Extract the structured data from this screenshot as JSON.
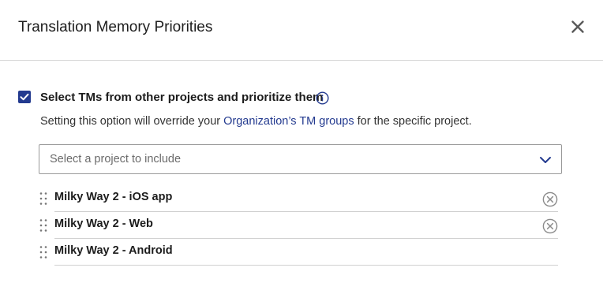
{
  "dialog": {
    "title": "Translation Memory Priorities",
    "close_icon": "close-icon"
  },
  "option": {
    "checked": true,
    "label": "Select TMs from other projects and prioritize them",
    "info_icon": "info-icon",
    "help_prefix": "Setting this option will override your ",
    "help_link": "Organization’s TM groups",
    "help_suffix": " for the specific project."
  },
  "project_select": {
    "placeholder": "Select a project to include",
    "chevron_icon": "chevron-down-icon"
  },
  "projects": [
    {
      "label": "Milky Way 2 - iOS app",
      "removable": true
    },
    {
      "label": "Milky Way 2 - Web",
      "removable": true
    },
    {
      "label": "Milky Way 2 - Android",
      "removable": false
    }
  ],
  "colors": {
    "accent": "#233a8f",
    "text": "#1c1c1c",
    "divider": "#d0d0d0"
  }
}
